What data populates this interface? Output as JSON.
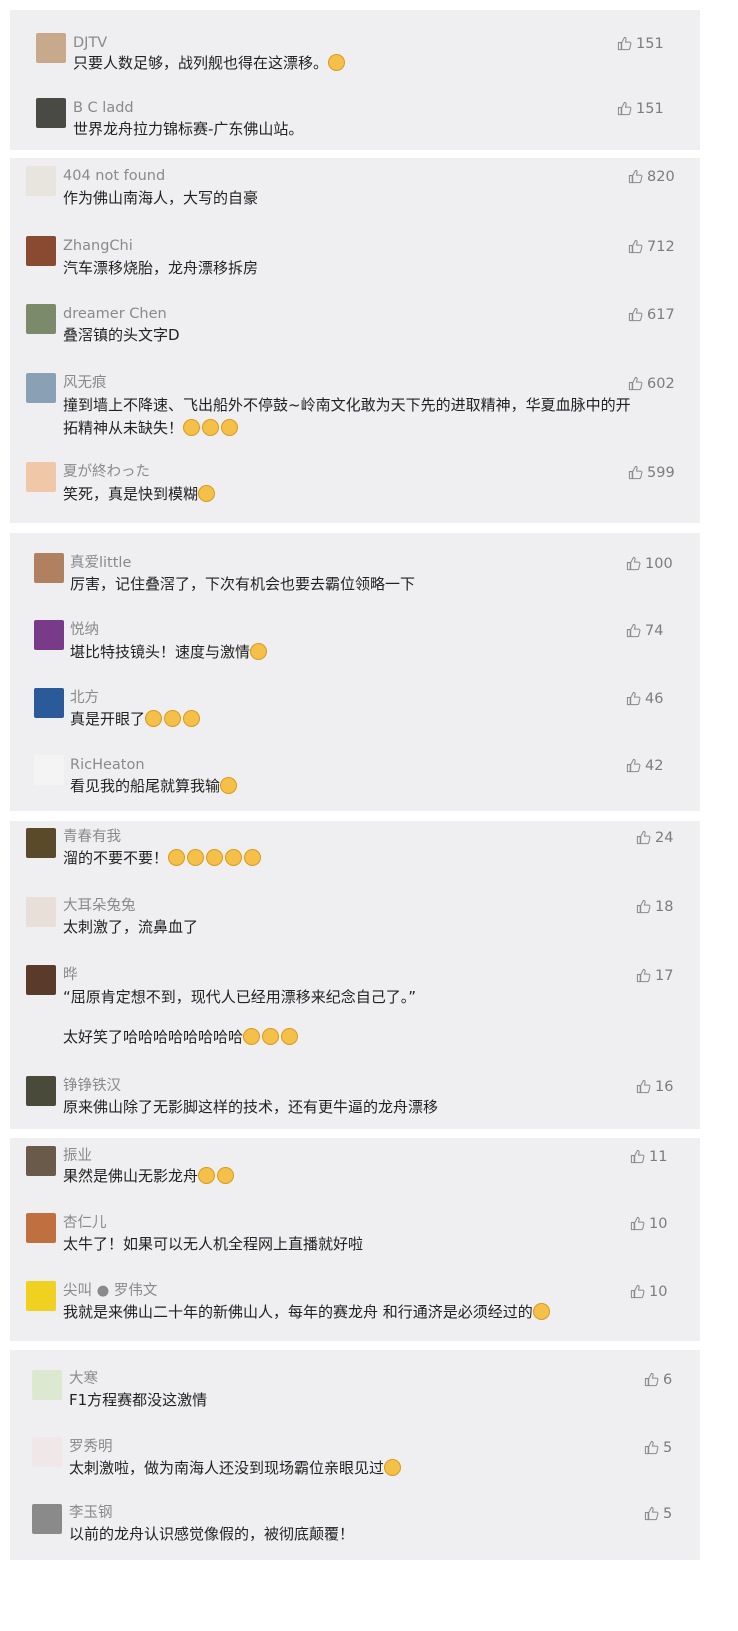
{
  "colors": {
    "panel_bg": "#efeff1",
    "name": "#8a8a8a",
    "text": "#222222",
    "likes": "#7c7c7c",
    "emoji": "#f4c04a"
  },
  "groups": [
    {
      "comments": [
        {
          "name": "DJTV",
          "text": "只要人数足够，战列舰也得在这漂移。",
          "likes": "151",
          "emoji": 1,
          "avatar": "#c9a98c"
        },
        {
          "name": "B C ladd",
          "text": "世界龙舟拉力锦标赛-广东佛山站。",
          "likes": "151",
          "emoji": 0,
          "avatar": "#4a4a44"
        }
      ]
    },
    {
      "comments": [
        {
          "name": "404 not found",
          "text": "作为佛山南海人，大写的自豪",
          "likes": "820",
          "emoji": 0,
          "avatar": "#e8e4de"
        },
        {
          "name": "ZhangChi",
          "text": "汽车漂移烧胎，龙舟漂移拆房",
          "likes": "712",
          "emoji": 0,
          "avatar": "#8a4a32"
        },
        {
          "name": "dreamer Chen",
          "text": "叠滘镇的头文字D",
          "likes": "617",
          "emoji": 0,
          "avatar": "#7a8a6a"
        },
        {
          "name": "风无痕",
          "text": "撞到墙上不降速、飞出船外不停鼓~岭南文化敢为天下先的进取精神，华夏血脉中的开",
          "text2": "拓精神从未缺失！",
          "likes": "602",
          "emoji": 3,
          "avatar": "#8aa0b4"
        },
        {
          "name": "夏が終わった",
          "text": "笑死，真是快到模糊",
          "likes": "599",
          "emoji": 1,
          "avatar": "#f0c8a8"
        }
      ]
    },
    {
      "comments": [
        {
          "name": "真爱little",
          "text": "厉害，记住叠滘了，下次有机会也要去霸位领略一下",
          "likes": "100",
          "emoji": 0,
          "avatar": "#b08060"
        },
        {
          "name": "悦纳",
          "text": "堪比特技镜头！速度与激情",
          "likes": "74",
          "emoji": 1,
          "avatar": "#7a3a8a"
        },
        {
          "name": "北方",
          "text": "真是开眼了",
          "likes": "46",
          "emoji": 3,
          "avatar": "#2a5a9a"
        },
        {
          "name": "RicHeaton",
          "text": "看见我的船尾就算我输",
          "likes": "42",
          "emoji": 1,
          "avatar": "#f4f4f4"
        }
      ]
    },
    {
      "comments": [
        {
          "name": "青春有我",
          "text": "溜的不要不要！",
          "likes": "24",
          "emoji": 5,
          "avatar": "#5a4a2a"
        },
        {
          "name": "大耳朵兔兔",
          "text": "太刺激了，流鼻血了",
          "likes": "18",
          "emoji": 0,
          "avatar": "#e8e0d8"
        },
        {
          "name": "晔",
          "text": "“屈原肯定想不到，现代人已经用漂移来纪念自己了。”",
          "text2": "太好笑了哈哈哈哈哈哈哈哈",
          "likes": "17",
          "emoji": 3,
          "avatar": "#5a3a2a"
        },
        {
          "name": "铮铮铁汉",
          "text": "原来佛山除了无影脚这样的技术，还有更牛逼的龙舟漂移",
          "likes": "16",
          "emoji": 0,
          "avatar": "#4a4a3a"
        }
      ]
    },
    {
      "comments": [
        {
          "name": "振业",
          "text": "果然是佛山无影龙舟",
          "likes": "11",
          "emoji": 2,
          "avatar": "#6a5a4a"
        },
        {
          "name": "杏仁儿",
          "text": "太牛了！如果可以无人机全程网上直播就好啦",
          "likes": "10",
          "emoji": 0,
          "avatar": "#c07040"
        },
        {
          "name": "尖叫 ● 罗伟文",
          "text": "我就是来佛山二十年的新佛山人，每年的赛龙舟   和行通济是必须经过的",
          "likes": "10",
          "emoji": 1,
          "avatar": "#f0d020"
        }
      ]
    },
    {
      "comments": [
        {
          "name": "大寒",
          "text": "F1方程赛都没这激情",
          "likes": "6",
          "emoji": 0,
          "avatar": "#dde8d0"
        },
        {
          "name": "罗秀明",
          "text": "太刺激啦，做为南海人还没到现场霸位亲眼见过",
          "likes": "5",
          "emoji": 1,
          "avatar": "#f0e8e8"
        },
        {
          "name": "李玉钢",
          "text": "以前的龙舟认识感觉像假的，被彻底颠覆！",
          "likes": "5",
          "emoji": 0,
          "avatar": "#8a8a8a"
        }
      ]
    }
  ]
}
